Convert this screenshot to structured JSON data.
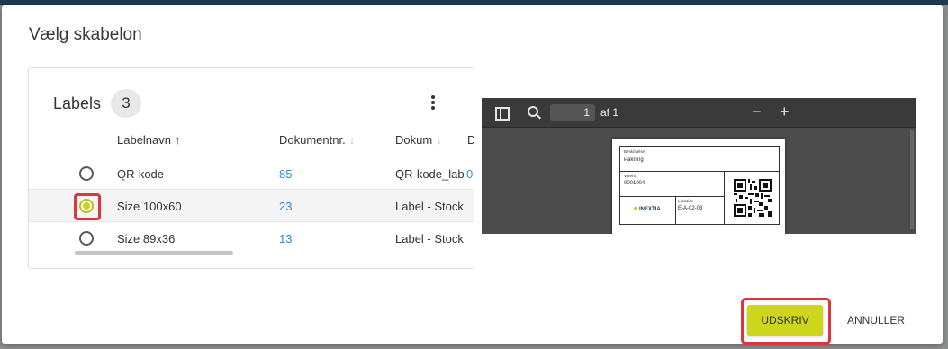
{
  "dialog": {
    "title": "Vælg skabelon"
  },
  "labels_card": {
    "title": "Labels",
    "count": "3",
    "columns": [
      {
        "label": "Labelnavn",
        "sort": "↑"
      },
      {
        "label": "Dokumentnr.",
        "sort": "↓"
      },
      {
        "label": "Dokum",
        "sort": "↓"
      },
      {
        "label": "D"
      }
    ],
    "rows": [
      {
        "name": "QR-kode",
        "docnr": "85",
        "doc": "QR-kode_label",
        "selected": false
      },
      {
        "name": "Size 100x60",
        "docnr": "23",
        "doc": "Label - Stock",
        "selected": true
      },
      {
        "name": "Size 89x36",
        "docnr": "13",
        "doc": "Label - Stock",
        "selected": false
      }
    ],
    "row0_trailing": "0"
  },
  "pdf_viewer": {
    "page_number": "1",
    "page_of": "af 1",
    "zoom_out": "−",
    "zoom_in": "+",
    "label": {
      "desc_caption": "Beskrivelse",
      "desc_value": "Pakning",
      "varenr_caption": "Varenr.",
      "varenr_value": "0001004",
      "location_caption": "Lokation",
      "location_value": "E-A-02-03",
      "logo_text": "INEXTIA"
    }
  },
  "buttons": {
    "print": "UDSKRIV",
    "cancel": "ANNULLER"
  },
  "colors": {
    "accent": "#cdd61a",
    "highlight": "#d9363e",
    "link": "#2a90d4"
  }
}
